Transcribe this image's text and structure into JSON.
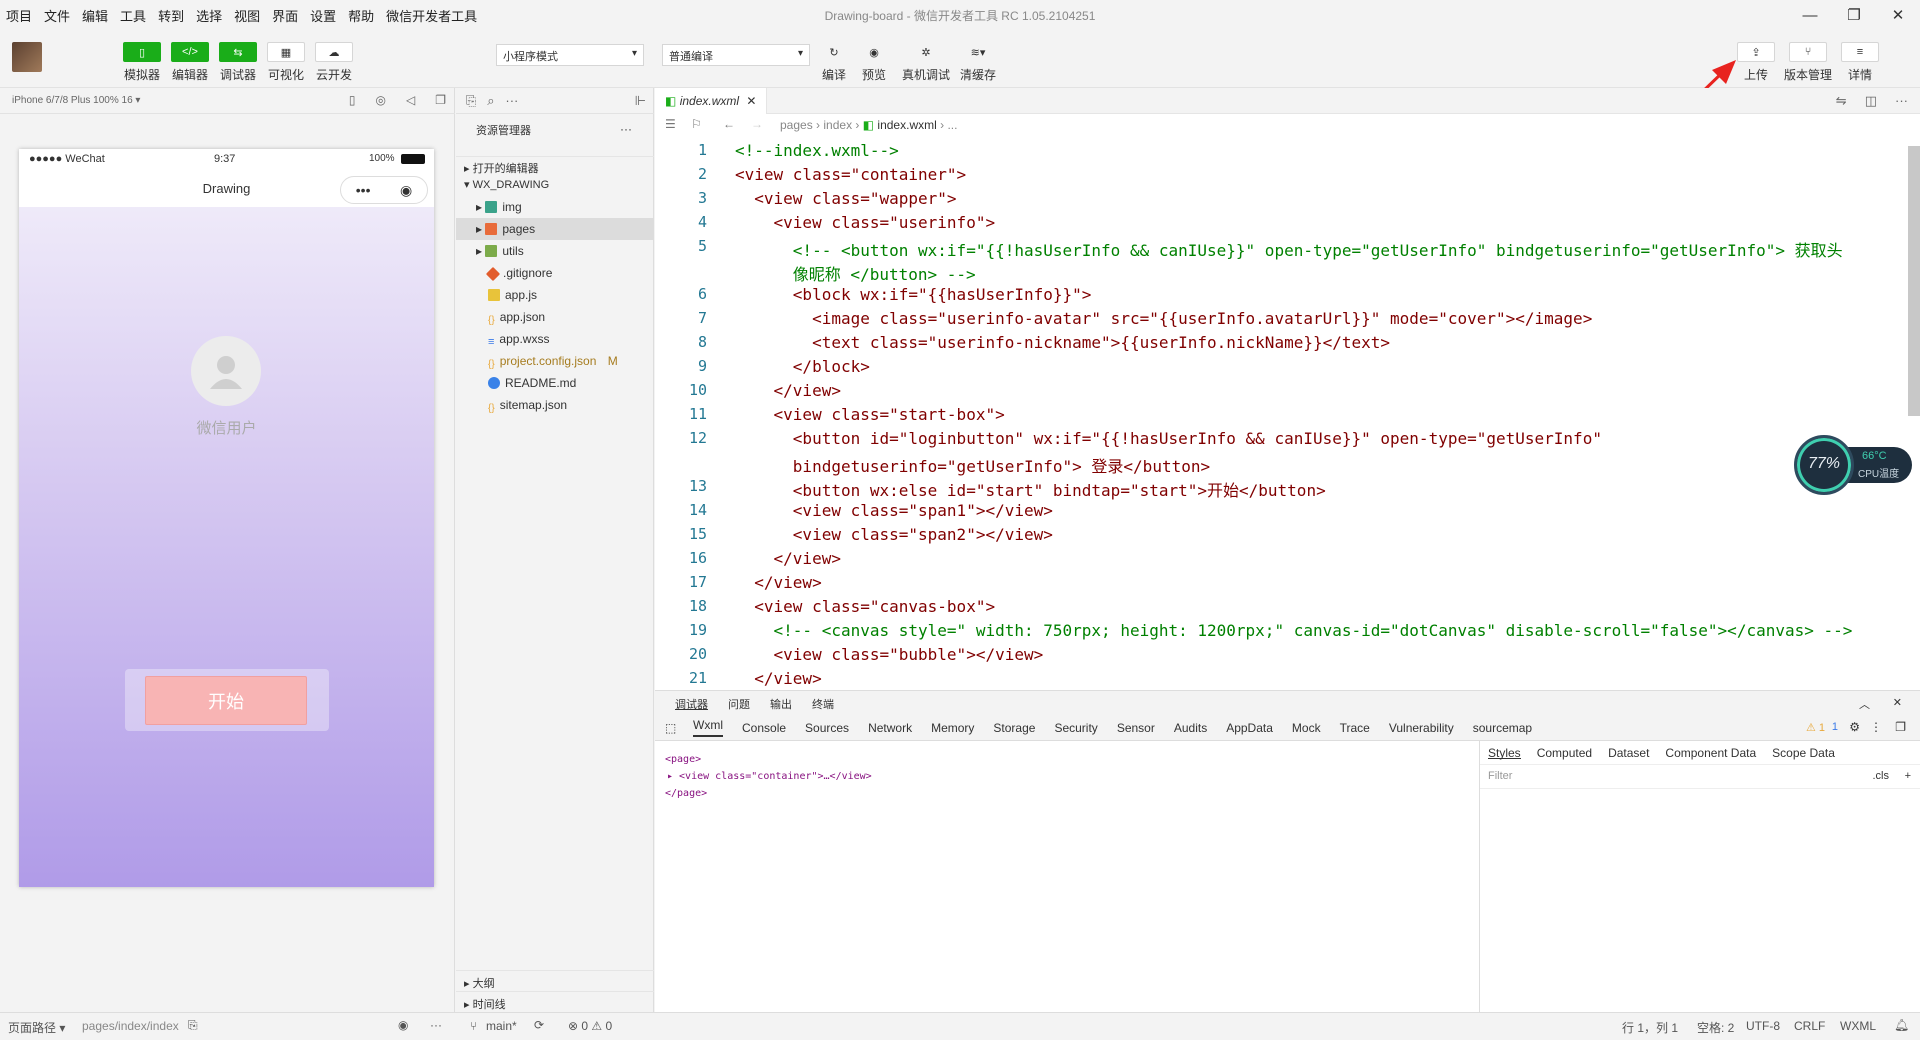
{
  "menu": [
    "项目",
    "文件",
    "编辑",
    "工具",
    "转到",
    "选择",
    "视图",
    "界面",
    "设置",
    "帮助",
    "微信开发者工具"
  ],
  "window_title": "Drawing-board - 微信开发者工具 RC 1.05.2104251",
  "toolbar": {
    "left": [
      "模拟器",
      "编辑器",
      "调试器",
      "可视化",
      "云开发"
    ],
    "mode_select": "小程序模式",
    "compile_select": "普通编译",
    "mid": [
      "编译",
      "预览",
      "真机调试",
      "清缓存"
    ],
    "right": [
      "上传",
      "版本管理",
      "详情"
    ]
  },
  "simulator": {
    "device": "iPhone 6/7/8 Plus 100% 16 ▾",
    "status_signal": "●●●●● WeChat",
    "status_time": "9:37",
    "status_battery": "100%",
    "nav_title": "Drawing",
    "capsule_dots": "•••",
    "user_name": "微信用户",
    "start_label": "开始"
  },
  "explorer": {
    "title": "资源管理器",
    "more": "···",
    "open_editors": "打开的编辑器",
    "project": "WX_DRAWING",
    "files": [
      {
        "name": "img",
        "color": "#3aa28a"
      },
      {
        "name": "pages",
        "color": "#e86b3a"
      },
      {
        "name": "utils",
        "color": "#7cab4a"
      },
      {
        "name": ".gitignore",
        "color": "#e25c2c"
      },
      {
        "name": "app.js",
        "color": "#e8c33a"
      },
      {
        "name": "app.json",
        "color": "#e8a83a"
      },
      {
        "name": "app.wxss",
        "color": "#3a7ae8"
      },
      {
        "name": "project.config.json",
        "color": "#e8a83a"
      },
      {
        "name": "README.md",
        "color": "#3a82e8"
      },
      {
        "name": "sitemap.json",
        "color": "#e8a83a"
      }
    ],
    "modified_flag": "M",
    "outline": "大纲",
    "timeline": "时间线"
  },
  "editor": {
    "tab": "index.wxml",
    "breadcrumb": [
      "pages",
      "index",
      "index.wxml",
      "..."
    ]
  },
  "code_lines": [
    {
      "n": "1",
      "text": "<!--index.wxml-->"
    },
    {
      "n": "2",
      "text": "<view class=\"container\">"
    },
    {
      "n": "3",
      "text": "  <view class=\"wapper\">"
    },
    {
      "n": "4",
      "text": "    <view class=\"userinfo\">"
    },
    {
      "n": "5",
      "text": "      <!-- <button wx:if=\"{{!hasUserInfo && canIUse}}\" open-type=\"getUserInfo\" bindgetuserinfo=\"getUserInfo\"> 获取头"
    },
    {
      "n": "",
      "text": "      像昵称 </button> -->"
    },
    {
      "n": "6",
      "text": "      <block wx:if=\"{{hasUserInfo}}\">"
    },
    {
      "n": "7",
      "text": "        <image class=\"userinfo-avatar\" src=\"{{userInfo.avatarUrl}}\" mode=\"cover\"></image>"
    },
    {
      "n": "8",
      "text": "        <text class=\"userinfo-nickname\">{{userInfo.nickName}}</text>"
    },
    {
      "n": "9",
      "text": "      </block>"
    },
    {
      "n": "10",
      "text": "    </view>"
    },
    {
      "n": "11",
      "text": "    <view class=\"start-box\">"
    },
    {
      "n": "12",
      "text": "      <button id=\"loginbutton\" wx:if=\"{{!hasUserInfo && canIUse}}\" open-type=\"getUserInfo\""
    },
    {
      "n": "",
      "text": "      bindgetuserinfo=\"getUserInfo\"> 登录</button>"
    },
    {
      "n": "13",
      "text": "      <button wx:else id=\"start\" bindtap=\"start\">开始</button>"
    },
    {
      "n": "14",
      "text": "      <view class=\"span1\"></view>"
    },
    {
      "n": "15",
      "text": "      <view class=\"span2\"></view>"
    },
    {
      "n": "16",
      "text": "    </view>"
    },
    {
      "n": "17",
      "text": "  </view>"
    },
    {
      "n": "18",
      "text": "  <view class=\"canvas-box\">"
    },
    {
      "n": "19",
      "text": "    <!-- <canvas style=\" width: 750rpx; height: 1200rpx;\" canvas-id=\"dotCanvas\" disable-scroll=\"false\"></canvas> -->"
    },
    {
      "n": "20",
      "text": "    <view class=\"bubble\"></view>"
    },
    {
      "n": "21",
      "text": "  </view>"
    }
  ],
  "devtools": {
    "top_tabs": [
      "调试器",
      "问题",
      "输出",
      "终端"
    ],
    "tabs": [
      "Wxml",
      "Console",
      "Sources",
      "Network",
      "Memory",
      "Storage",
      "Security",
      "Sensor",
      "Audits",
      "AppData",
      "Mock",
      "Trace",
      "Vulnerability",
      "sourcemap"
    ],
    "warn": "⚠ 1",
    "info": "1",
    "wxml": [
      "<page>",
      "▸ <view class=\"container\">…</view>",
      "</page>"
    ],
    "style_tabs": [
      "Styles",
      "Computed",
      "Dataset",
      "Component Data",
      "Scope Data"
    ],
    "filter": "Filter",
    "cls": ".cls",
    "plus": "+"
  },
  "statusbar": {
    "page_path_label": "页面路径 ▾",
    "page_path": "pages/index/index",
    "branch": "main*",
    "errors": "⊗ 0 ⚠ 0",
    "position": "行 1，列 1",
    "spaces": "空格: 2",
    "encoding": "UTF-8",
    "eol": "CRLF",
    "lang": "WXML"
  },
  "cpu": {
    "percent": "77%",
    "temp": "66°C",
    "label": "CPU温度"
  },
  "colors": {
    "green": "#1aad19",
    "arrow": "#e8231f"
  }
}
